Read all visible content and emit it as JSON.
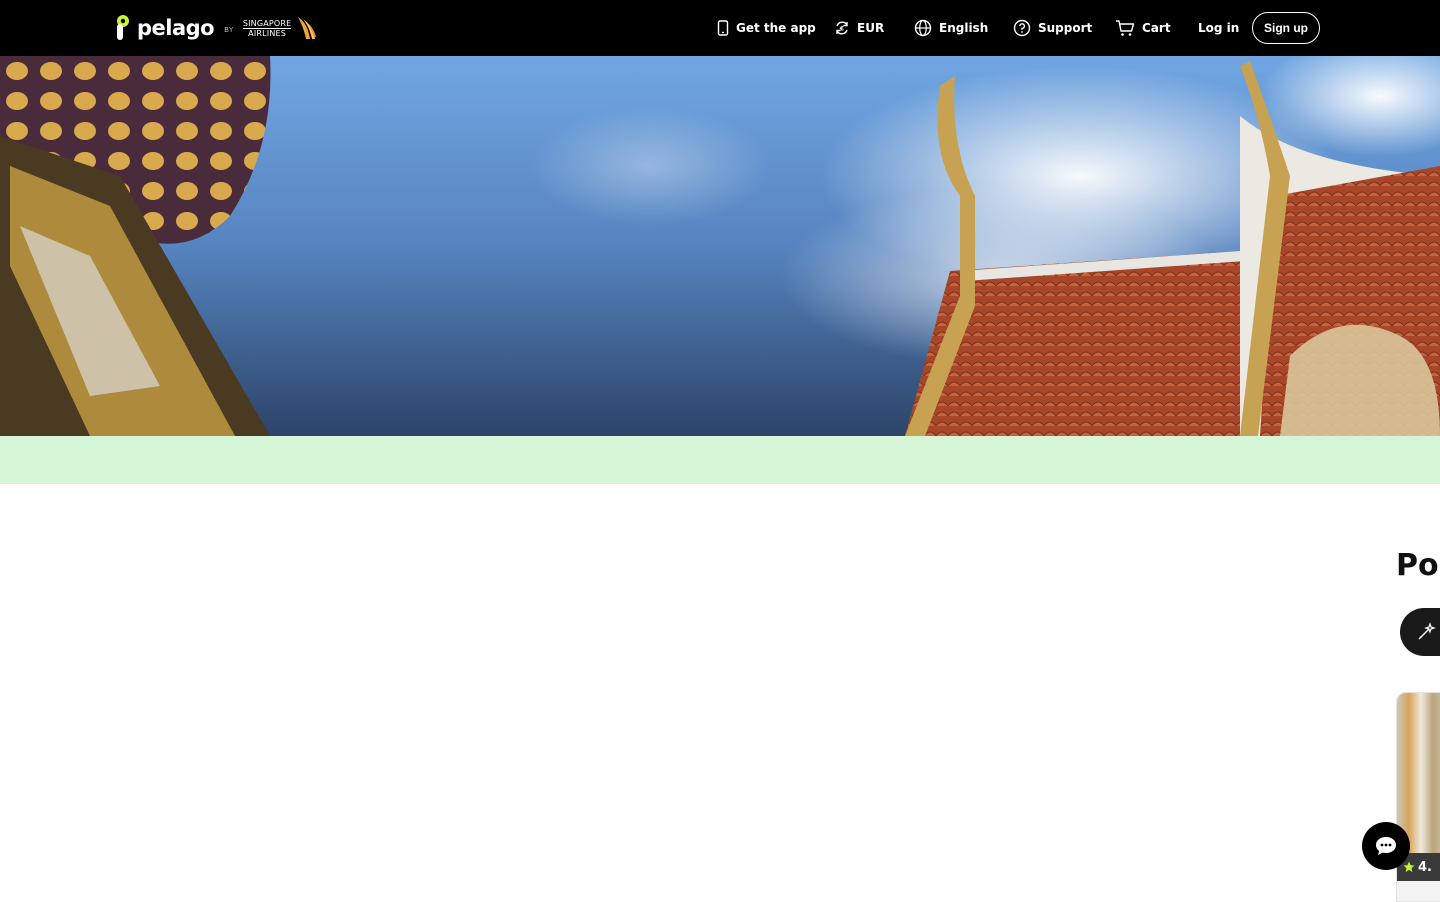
{
  "brand": {
    "name": "pelago",
    "by": "BY",
    "partner_line1": "SINGAPORE",
    "partner_line2": "AIRLINES"
  },
  "nav": {
    "get_app": "Get the app",
    "currency": "EUR",
    "language": "English",
    "support": "Support",
    "cart": "Cart",
    "login": "Log in",
    "signup": "Sign up"
  },
  "section": {
    "title": "Pop"
  },
  "card": {
    "rating": "4."
  },
  "colors": {
    "nav_bg": "#000000",
    "banner_bg": "#d4f6d6",
    "accent_star": "#c6f432",
    "logo_green": "#c6f432"
  },
  "icons": {
    "get_app": "phone-icon",
    "currency": "currency-exchange-icon",
    "language": "globe-icon",
    "support": "help-circle-icon",
    "cart": "cart-icon",
    "filter": "sparkle-wand-icon",
    "rating": "star-icon",
    "chat": "chat-bubble-icon"
  }
}
